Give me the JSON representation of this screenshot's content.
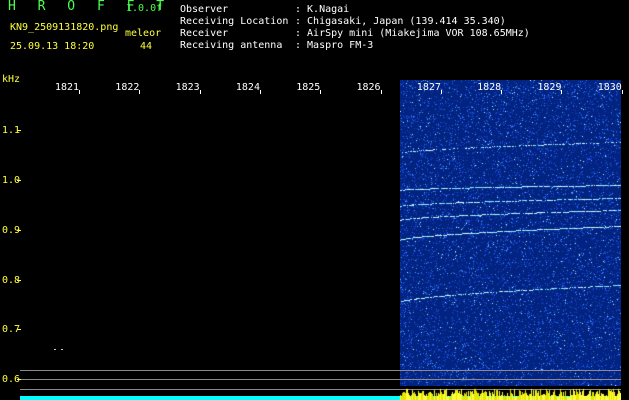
{
  "app": {
    "title": "H R O F F T",
    "version": "1.0.0f",
    "filename": "KN9_2509131820.png",
    "mode": "meleor",
    "datetime": "25.09.13 18:20",
    "count": "44"
  },
  "info": {
    "observer_label": "Observer",
    "observer_value": ": K.Nagai",
    "location_label": "Receiving Location",
    "location_value": ": Chigasaki, Japan (139.414 35.340)",
    "receiver_label": "Receiver",
    "receiver_value": ": AirSpy mini (Miakejima VOR 108.65MHz)",
    "antenna_label": "Receiving antenna",
    "antenna_value": ": Maspro FM-3"
  },
  "axis": {
    "y_unit": "kHz",
    "y_labels": [
      "1.1",
      "1.0",
      "0.9",
      "0.8",
      "0.7",
      "0.6"
    ],
    "x_labels": [
      "1821",
      "1822",
      "1823",
      "1824",
      "1825",
      "1826",
      "1827",
      "1828",
      "1829",
      "1830"
    ]
  },
  "colors": {
    "background": "#000000",
    "spectrogram_bg": "#03248c",
    "signal": "#7ff0ff",
    "axis_text": "#ffff3c",
    "title_text": "#4cff4c",
    "baseline": "#00ffff"
  }
}
